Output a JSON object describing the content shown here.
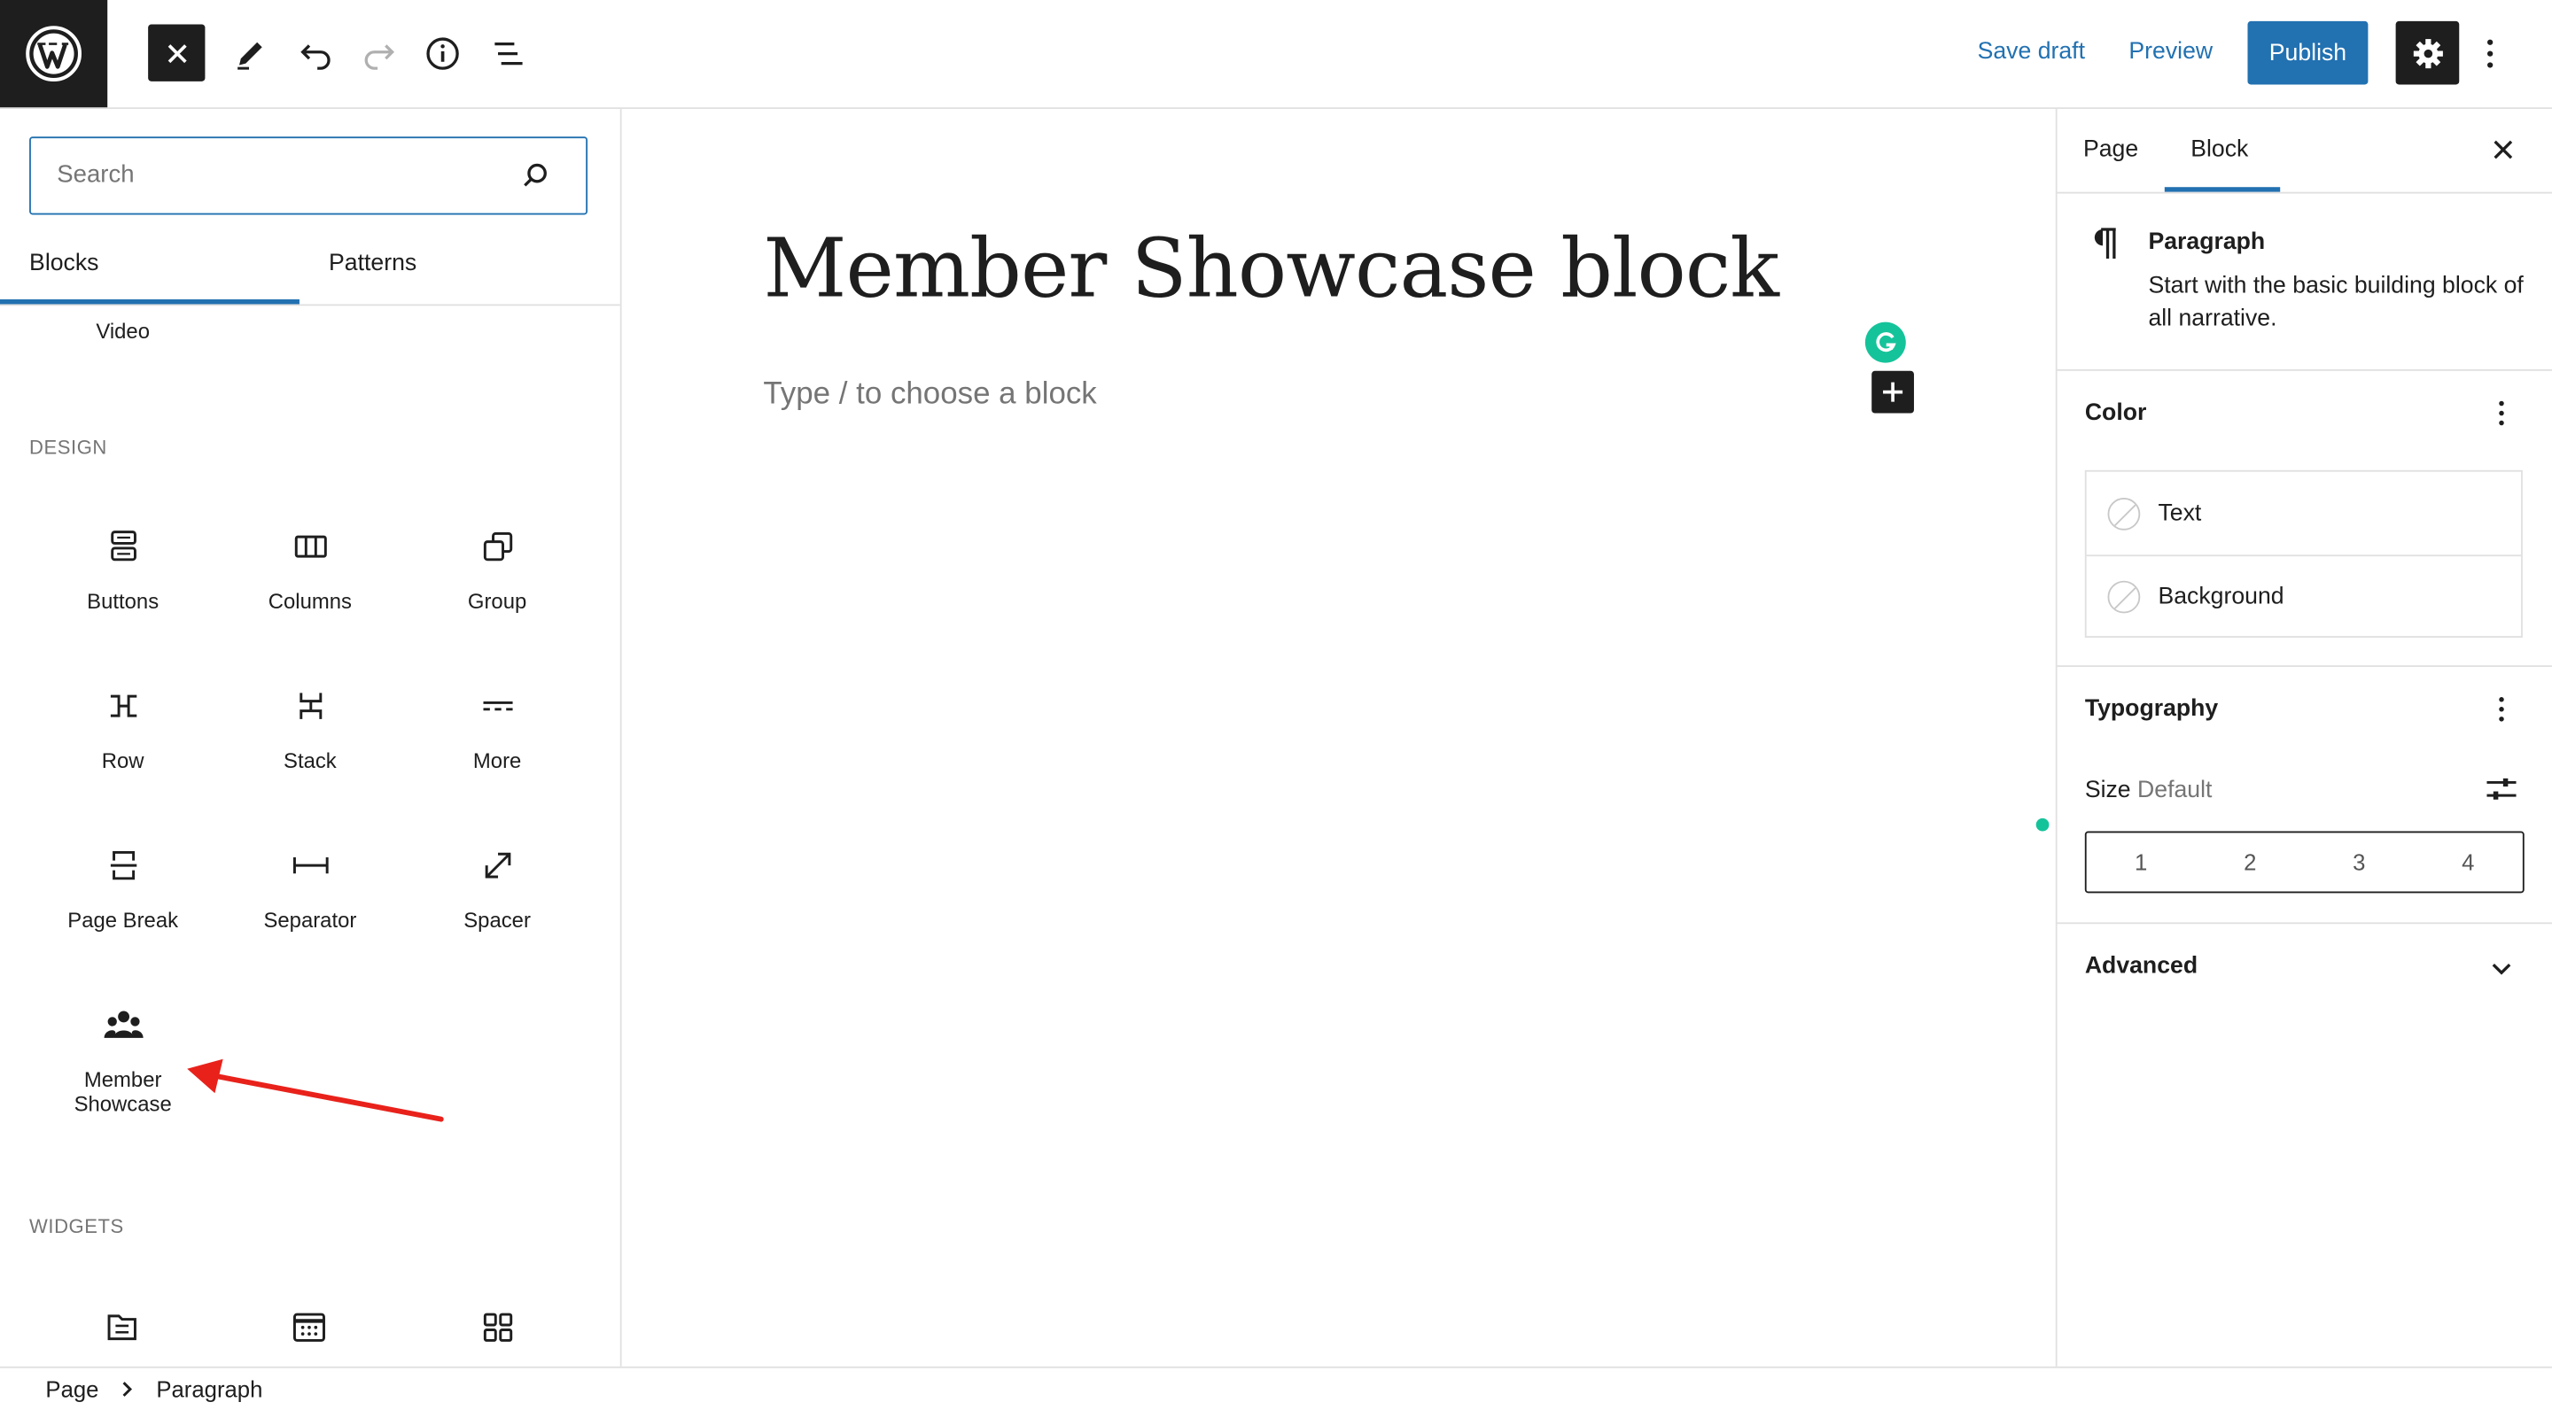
{
  "toolbar": {
    "save_draft": "Save draft",
    "preview": "Preview",
    "publish": "Publish"
  },
  "inserter": {
    "search_placeholder": "Search",
    "tabs": [
      "Blocks",
      "Patterns"
    ],
    "active_tab": "Blocks",
    "partial_item": "Video",
    "categories": {
      "design": "DESIGN",
      "widgets": "WIDGETS"
    },
    "design_blocks": [
      {
        "label": "Buttons",
        "icon": "buttons-icon"
      },
      {
        "label": "Columns",
        "icon": "columns-icon"
      },
      {
        "label": "Group",
        "icon": "group-icon"
      },
      {
        "label": "Row",
        "icon": "row-icon"
      },
      {
        "label": "Stack",
        "icon": "stack-icon"
      },
      {
        "label": "More",
        "icon": "more-icon"
      },
      {
        "label": "Page Break",
        "icon": "page-break-icon"
      },
      {
        "label": "Separator",
        "icon": "separator-icon"
      },
      {
        "label": "Spacer",
        "icon": "spacer-icon"
      },
      {
        "label_line1": "Member",
        "label_line2": "Showcase",
        "icon": "members-icon"
      }
    ],
    "widget_icons": [
      "archive-icon",
      "calendar-icon",
      "categories-icon"
    ]
  },
  "editor": {
    "title": "Member Showcase block",
    "placeholder": "Type / to choose a block"
  },
  "sidebar": {
    "tabs": [
      "Page",
      "Block"
    ],
    "active_tab": "Block",
    "block": {
      "name": "Paragraph",
      "description": "Start with the basic building block of all narrative."
    },
    "color": {
      "title": "Color",
      "items": [
        "Text",
        "Background"
      ]
    },
    "typography": {
      "title": "Typography",
      "size_label": "Size",
      "size_value": "Default",
      "sizes": [
        "1",
        "2",
        "3",
        "4"
      ]
    },
    "advanced": {
      "title": "Advanced"
    }
  },
  "breadcrumb": [
    "Page",
    "Paragraph"
  ],
  "colors": {
    "accent": "#2271b1",
    "dark": "#1e1e1e",
    "grammarly": "#15c39a",
    "annotation_arrow": "#e8221b"
  }
}
